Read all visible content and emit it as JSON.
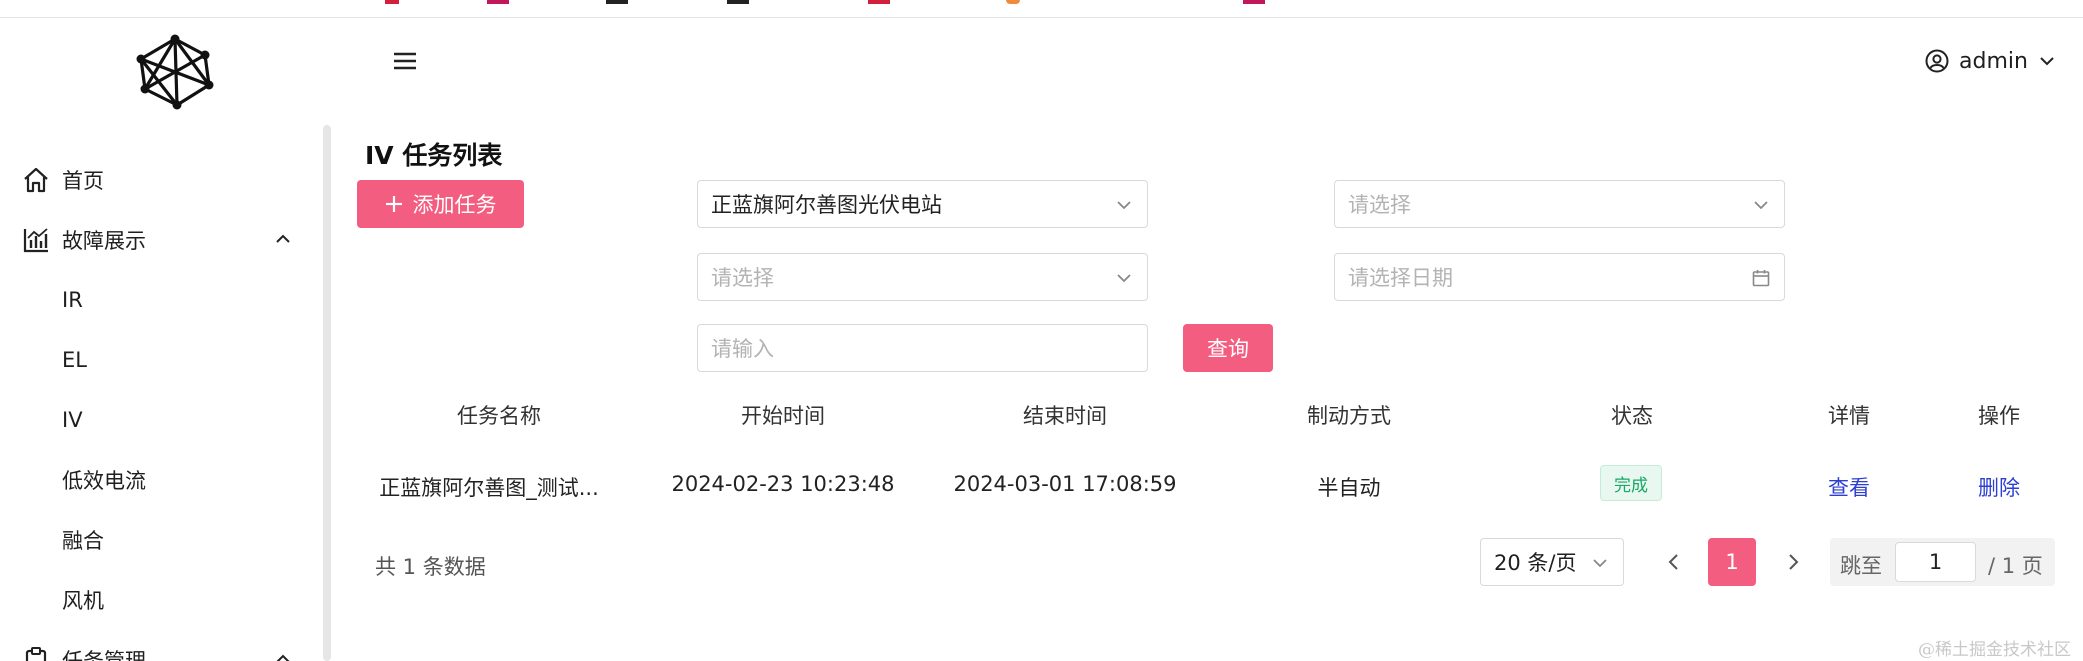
{
  "colors": {
    "accent": "#f25d80",
    "link": "#2d3fd0",
    "success": "#19a866"
  },
  "header": {
    "logo_icon": "network-logo-icon",
    "menu_icon": "hamburger-icon",
    "user": {
      "icon": "user-circle-icon",
      "name": "admin",
      "chevron": "chevron-down-icon"
    }
  },
  "sidebar": {
    "items": [
      {
        "label": "首页",
        "icon": "home-icon"
      },
      {
        "label": "故障展示",
        "icon": "chart-icon",
        "expanded": true,
        "children": [
          "IR",
          "EL",
          "IV",
          "低效电流",
          "融合",
          "风机"
        ]
      },
      {
        "label": "任务管理",
        "icon": "clipboard-icon",
        "expanded": true
      }
    ]
  },
  "main": {
    "title": "IV 任务列表",
    "add_button": "添加任务",
    "filters": {
      "station": "正蓝旗阿尔善图光伏电站",
      "select_2_placeholder": "请选择",
      "select_3_placeholder": "请选择",
      "date_placeholder": "请选择日期",
      "input_placeholder": "请输入"
    },
    "query_button": "查询"
  },
  "table": {
    "columns": [
      "任务名称",
      "开始时间",
      "结束时间",
      "制动方式",
      "状态",
      "详情",
      "操作"
    ],
    "rows": [
      {
        "name": "正蓝旗阿尔善图_测试...",
        "start": "2024-02-23 10:23:48",
        "end": "2024-03-01 17:08:59",
        "mode": "半自动",
        "status": "完成",
        "detail": "查看",
        "action": "删除"
      }
    ]
  },
  "pagination": {
    "total_text": "共 1 条数据",
    "page_size": "20 条/页",
    "current_page": "1",
    "jump_prefix": "跳至",
    "jump_value": "1",
    "jump_suffix": "/ 1 页"
  },
  "watermark": "@稀土掘金技术社区"
}
